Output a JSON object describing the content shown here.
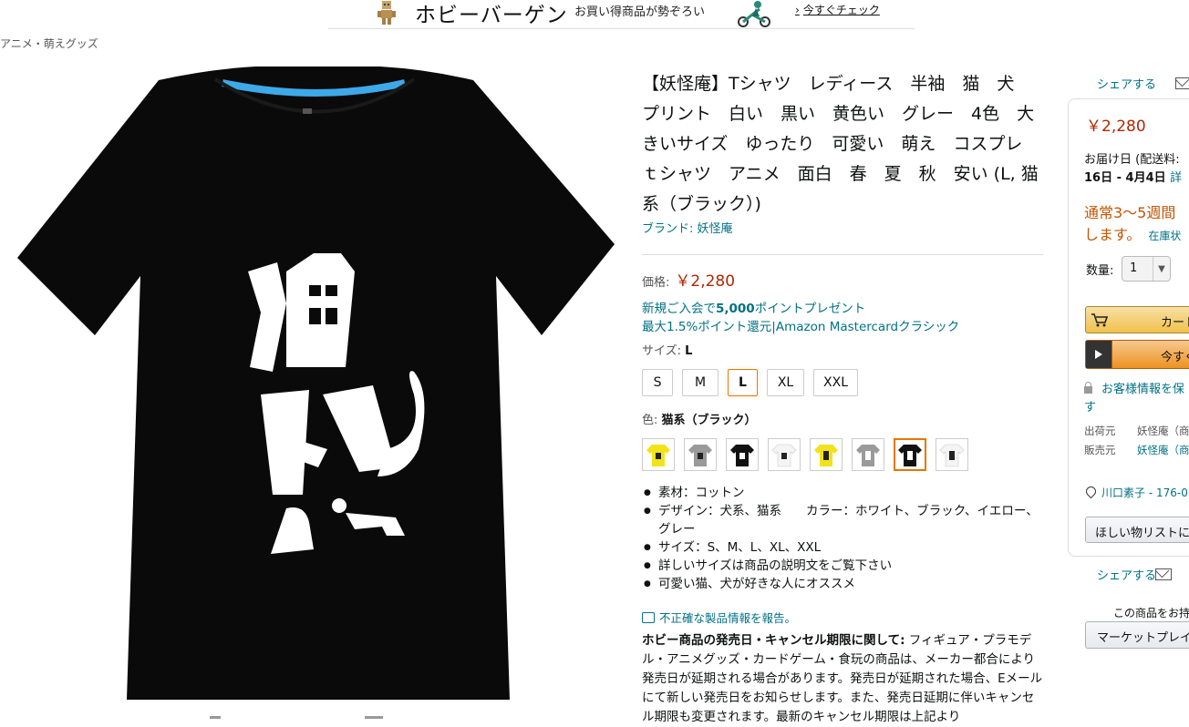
{
  "banner": {
    "title": "ホビーバーゲン",
    "subtitle": "お買い得商品が勢ぞろい",
    "cta": "今すぐチェック"
  },
  "breadcrumb": "アニメ・萌えグッズ",
  "product": {
    "title": "【妖怪庵】Tシャツ　レディース　半袖　猫　犬　プリント　白い　黒い　黄色い　グレー　4色　大きいサイズ　ゆったり　可愛い　萌え　コスプレ　ｔシャツ　アニメ　面白　春　夏　秋　安い (L, 猫系（ブラック）)",
    "brand": "ブランド: 妖怪庵",
    "price_label": "価格:",
    "price": "￥2,280",
    "promo_prefix": "新規ご入会で",
    "promo_points": "5,000",
    "promo_suffix": "ポイントプレゼント",
    "promo2": "最大1.5%ポイント還元|Amazon Mastercardクラシック",
    "size_label": "サイズ: ",
    "size_selected": "L",
    "sizes": [
      "S",
      "M",
      "L",
      "XL",
      "XXL"
    ],
    "color_label": "色: ",
    "color_selected": "猫系（ブラック）",
    "bullets": [
      "素材：コットン",
      "デザイン：犬系、猫系　　カラー：ホワイト、ブラック、イエロー、グレー",
      "サイズ：S、M、L、XL、XXL",
      "詳しいサイズは商品の説明文をご覧下さい",
      "可愛い猫、犬が好きな人にオススメ"
    ],
    "report": "不正確な製品情報を報告。",
    "hobby_bold": "ホビー商品の発売日・キャンセル期限に関して:",
    "hobby_text": " フィギュア・プラモデル・アニメグッズ・カードゲーム・食玩の商品は、メーカー都合により発売日が延期される場合があります。発売日が延期された場合、Eメールにて新しい発売日をお知らせします。また、発売日延期に伴いキャンセル期限も変更されます。最新のキャンセル期限は上記より"
  },
  "buybox": {
    "share": "シェアする",
    "price": "￥2,280",
    "delivery1": "お届け日 (配送料:",
    "delivery2": "16日 - 4月4日",
    "delivery_link": "詳",
    "stock1": "通常3～5週間",
    "stock2": "します。",
    "stock_link": "在庫状",
    "qty_label": "数量:",
    "qty_value": "1",
    "cart": "カートに",
    "buy_now": "今すぐ",
    "secure1": "お客様情報を保",
    "secure2": "す",
    "ship_from_label": "出荷元",
    "ship_from": "妖怪庵（商",
    "seller_label": "販売元",
    "seller": "妖怪庵（商",
    "address": "川口素子 - 176-0",
    "wishlist": "ほしい物リストに",
    "share2": "シェアする",
    "sell_label": "この商品をお持",
    "marketplace": "マーケットプレイ"
  },
  "colors": {
    "link": "#007185",
    "price": "#b12704",
    "stock": "#c45500",
    "selected": "#e77600"
  },
  "swatches": [
    "yellow-dog",
    "gray-dog",
    "black-dog",
    "white-dog",
    "yellow-cat",
    "gray-cat",
    "black-cat",
    "white-cat"
  ]
}
